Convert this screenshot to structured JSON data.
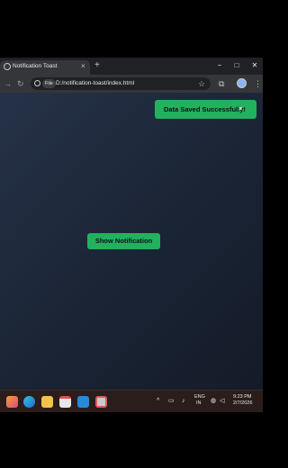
{
  "browser": {
    "tab_title": "Notification Toast",
    "new_tab_glyph": "+",
    "close_glyph": "×",
    "window_controls": {
      "minimize": "−",
      "maximize": "□",
      "close": "✕"
    },
    "file_label": "File",
    "url": "D:/notification-toast/index.html"
  },
  "page": {
    "toast_text": "Data Saved Successfully!",
    "toast_close": "×",
    "show_button_label": "Show Notification",
    "background_start": "#263248",
    "background_end": "#141b28",
    "accent": "#22b15e"
  },
  "taskbar": {
    "language": "ENG",
    "region": "IN",
    "time": "9:23 PM",
    "date": "2/7/2026",
    "apps": [
      "copilot-icon",
      "edge-icon",
      "file-explorer-icon",
      "calendar-icon",
      "vscode-icon",
      "snipping-tool-icon"
    ]
  }
}
